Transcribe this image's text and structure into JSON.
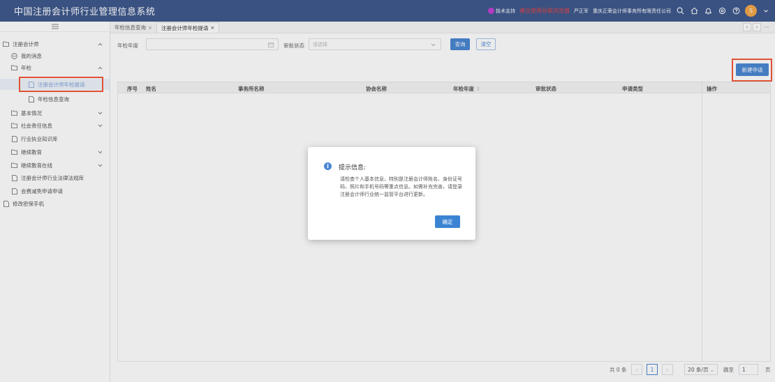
{
  "header": {
    "title": "中国注册会计师行业管理信息系统",
    "support_label": "技术支持",
    "warning_text": "建议使用谷歌浏览器",
    "user_name": "严正军",
    "firm_name": "重庆正荣会计师事务所有限责任公司",
    "avatar_letter": "S",
    "icons": [
      "search-icon",
      "home-icon",
      "bell-icon",
      "settings-icon",
      "help-icon"
    ]
  },
  "sidebar": {
    "collapse_icon": "menu-icon",
    "items": [
      {
        "label": "注册会计师",
        "icon": "folder-icon",
        "chevron": "up"
      },
      {
        "label": "我的消息",
        "icon": "message-icon"
      },
      {
        "label": "年检",
        "icon": "folder-icon",
        "chevron": "up"
      },
      {
        "label": "注册会计师年检提请",
        "icon": "doc-icon",
        "active": true
      },
      {
        "label": "年检信息查询",
        "icon": "doc-icon"
      },
      {
        "label": "基本情况",
        "icon": "folder-icon",
        "chevron": "down"
      },
      {
        "label": "社会责任信息",
        "icon": "folder-icon",
        "chevron": "down"
      },
      {
        "label": "行业执业知识库",
        "icon": "doc-icon"
      },
      {
        "label": "继续教育",
        "icon": "folder-icon",
        "chevron": "down"
      },
      {
        "label": "继续教育在线",
        "icon": "folder-icon",
        "chevron": "down"
      },
      {
        "label": "注册会计师行业法律法规库",
        "icon": "doc-icon"
      },
      {
        "label": "会费减免申请申请",
        "icon": "doc-icon"
      },
      {
        "label": "修改密保手机",
        "icon": "doc-icon"
      }
    ]
  },
  "tabs": [
    {
      "label": "年检信息查询",
      "active": false
    },
    {
      "label": "注册会计师年检提请",
      "active": true
    }
  ],
  "filter": {
    "year_label": "年检年度",
    "year_value": "",
    "status_label": "审批状态",
    "status_placeholder": "请选择",
    "search_label": "查询",
    "clear_label": "清空",
    "new_label": "新建申请"
  },
  "table": {
    "columns": [
      "序号",
      "姓名",
      "事务所名称",
      "协会名称",
      "年检年度",
      "审批状态",
      "申请类型",
      "操作"
    ],
    "rows": []
  },
  "pagination": {
    "total": "共 0 条",
    "current": "1",
    "page_size": "20 条/页",
    "goto_label": "跳至",
    "goto_value": "1",
    "page_suffix": "页"
  },
  "modal": {
    "title": "提示信息:",
    "body": "请检查个人基本信息，特别是注册会计师姓名、身份证号码、照片和手机号码等重点信息。如需补充完善，请登录注册会计师行业统一监管平台进行更新。",
    "ok_label": "确定"
  },
  "colors": {
    "header_bg": "#3f5a8e",
    "primary": "#4a87d3",
    "highlight": "#f2593a",
    "warning": "#e64545"
  }
}
